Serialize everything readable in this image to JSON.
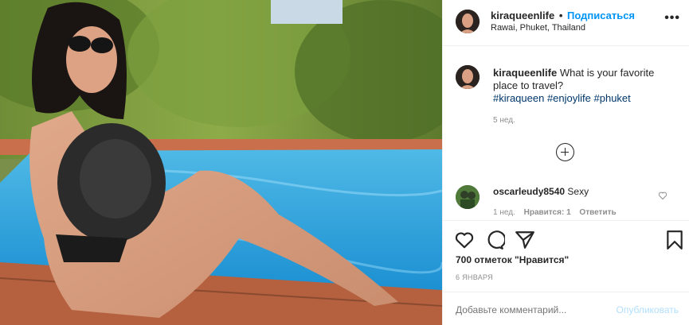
{
  "post": {
    "username": "kiraqueenlife",
    "follow_label": "Подписаться",
    "separator": "•",
    "location": "Rawai, Phuket, Thailand",
    "more_label": "•••"
  },
  "caption": {
    "username": "kiraqueenlife",
    "text": "What is your favorite place to travel?",
    "hashtags": [
      "#kiraqueen",
      "#enjoylife",
      "#phuket"
    ],
    "time": "5 нед."
  },
  "comment": {
    "username": "oscarleudy8540",
    "text": "Sexy",
    "time": "1 нед.",
    "likes": "Нравится: 1",
    "reply": "Ответить"
  },
  "stats": {
    "likes": "700 отметок \"Нравится\"",
    "date": "6 ЯНВАРЯ"
  },
  "add_comment": {
    "placeholder": "Добавьте комментарий...",
    "post_label": "Опубликовать"
  },
  "icons": {
    "like": "heart-icon",
    "comment": "comment-icon",
    "share": "share-icon",
    "save": "bookmark-icon",
    "load_more": "plus-circle-icon",
    "comment_like": "heart-icon"
  },
  "colors": {
    "accent": "#0095f6",
    "hashtag": "#00376b",
    "muted": "#8e8e8e",
    "post_disabled": "#b2dffc"
  }
}
